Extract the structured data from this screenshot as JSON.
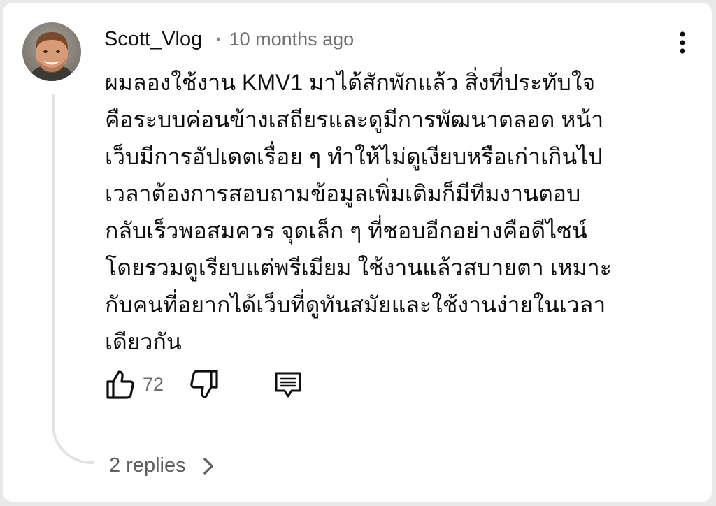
{
  "comment": {
    "author": "Scott_Vlog",
    "separator": "•",
    "time": "10 months ago",
    "lines": [
      "ผมลองใช้งาน KMV1 มาได้สักพักแล้ว สิ่งที่ประทับใจ",
      "คือระบบค่อนข้างเสถียรและดูมีการพัฒนาตลอด หน้า",
      "เว็บมีการอัปเดตเรื่อย ๆ ทำให้ไม่ดูเงียบหรือเก่าเกินไป",
      "เวลาต้องการสอบถามข้อมูลเพิ่มเติมก็มีทีมงานตอบ",
      "กลับเร็วพอสมควร จุดเล็ก ๆ ที่ชอบอีกอย่างคือดีไซน์",
      "โดยรวมดูเรียบแต่พรีเมียม ใช้งานแล้วสบายตา เหมาะ",
      "กับคนที่อยากได้เว็บที่ดูทันสมัยและใช้งานง่ายในเวลา",
      "เดียวกัน"
    ]
  },
  "actions": {
    "like_count": "72",
    "icons": {
      "like": "thumbs-up-icon",
      "dislike": "thumbs-down-icon",
      "reply": "reply-comment-icon",
      "more": "more-vertical-icon"
    }
  },
  "replies": {
    "label": "2 replies",
    "icon": "chevron-right-icon"
  },
  "colors": {
    "text": "#0f0f0f",
    "secondary": "#6f6f6f",
    "thread_line": "#e3e3e3"
  }
}
